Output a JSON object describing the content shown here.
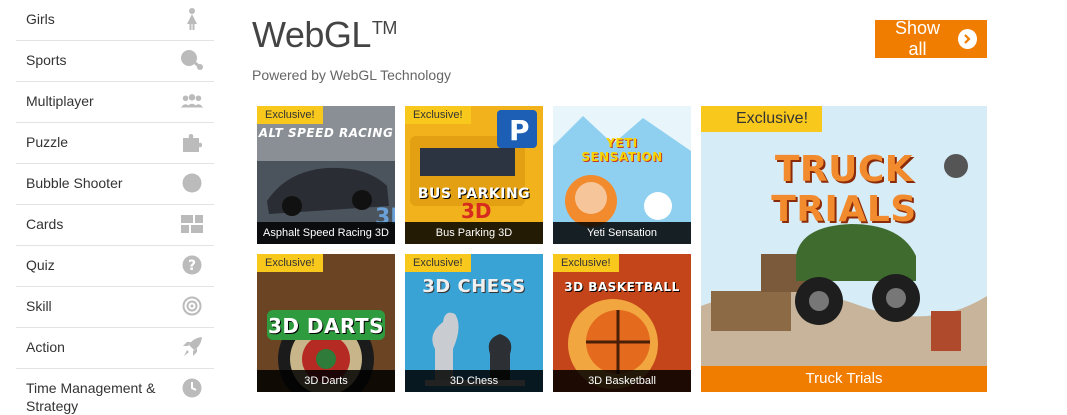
{
  "sidebar": {
    "items": [
      {
        "label": "Girls",
        "icon": "girl-icon"
      },
      {
        "label": "Sports",
        "icon": "ping-pong-icon"
      },
      {
        "label": "Multiplayer",
        "icon": "people-icon"
      },
      {
        "label": "Puzzle",
        "icon": "puzzle-icon"
      },
      {
        "label": "Bubble Shooter",
        "icon": "bubble-icon"
      },
      {
        "label": "Cards",
        "icon": "cards-grid-icon"
      },
      {
        "label": "Quiz",
        "icon": "question-icon"
      },
      {
        "label": "Skill",
        "icon": "target-icon"
      },
      {
        "label": "Action",
        "icon": "rocket-icon"
      },
      {
        "label": "Time Management & Strategy",
        "icon": "clock-icon"
      }
    ]
  },
  "header": {
    "title": "WebGL",
    "trademark": "TM",
    "subtitle": "Powered by WebGL Technology",
    "show_all_label": "Show all"
  },
  "games": [
    {
      "title": "Asphalt Speed Racing 3D",
      "badge": "Exclusive!",
      "art_text": "ALT SPEED RACING",
      "bg": "#3a4048"
    },
    {
      "title": "Bus Parking 3D",
      "badge": "Exclusive!",
      "art_text": "BUS PARKING",
      "bg": "#e9a91c"
    },
    {
      "title": "Yeti Sensation",
      "badge": "",
      "art_text": "YETI SENSATION",
      "bg": "#7fc8ec"
    },
    {
      "title": "3D Darts",
      "badge": "Exclusive!",
      "art_text": "3D DARTS",
      "bg": "#5b3a1e"
    },
    {
      "title": "3D Chess",
      "badge": "Exclusive!",
      "art_text": "3D CHESS",
      "bg": "#3aa3d6"
    },
    {
      "title": "3D Basketball",
      "badge": "Exclusive!",
      "art_text": "3D BASKETBALL",
      "bg": "#d8551a"
    }
  ],
  "featured": {
    "title": "Truck Trials",
    "badge": "Exclusive!",
    "art_text": "TRUCK TRIALS",
    "bg": "#cfe6f2"
  },
  "colors": {
    "accent": "#f07d00",
    "badge": "#f8c81c",
    "icon_gray": "#bbbbbb"
  }
}
